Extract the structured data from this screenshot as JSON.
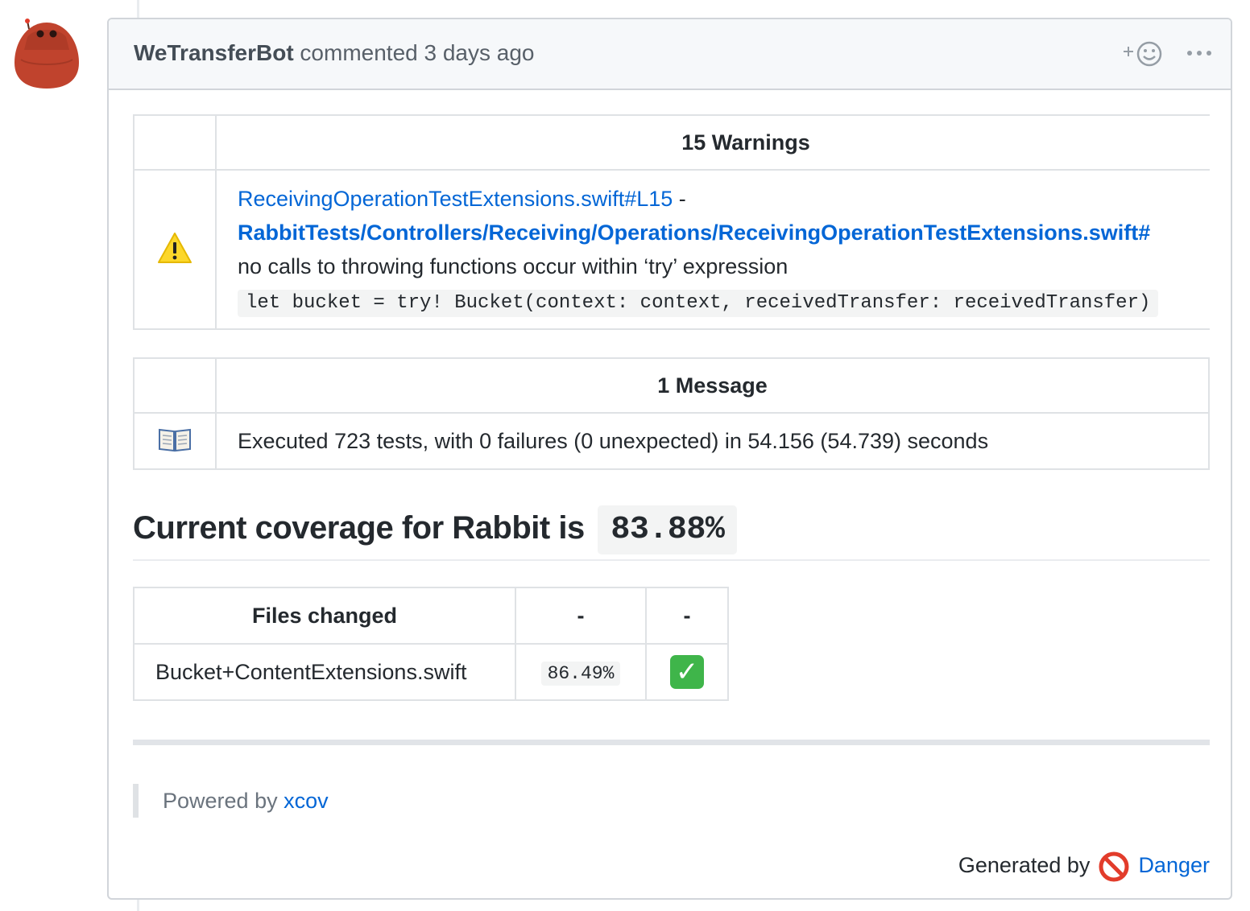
{
  "comment": {
    "author": "WeTransferBot",
    "action": "commented",
    "time": "3 days ago",
    "reaction_icon": "smiley-add-icon",
    "more_icon": "kebab-horizontal-icon"
  },
  "warnings": {
    "title": "15 Warnings",
    "icon": "warning-icon",
    "file_link": "ReceivingOperationTestExtensions.swift#L15",
    "separator": " -",
    "path_link": "RabbitTests/Controllers/Receiving/Operations/ReceivingOperationTestExtensions.swift#",
    "message": "no calls to throwing functions occur within ‘try’ expression",
    "code": "let bucket = try! Bucket(context: context, receivedTransfer: receivedTransfer)"
  },
  "messages": {
    "title": "1 Message",
    "icon": "book-icon",
    "text": "Executed 723 tests, with 0 failures (0 unexpected) in 54.156 (54.739) seconds"
  },
  "coverage": {
    "heading": "Current coverage for Rabbit is",
    "value": "83.88%"
  },
  "files_table": {
    "headers": [
      "Files changed",
      "-",
      "-"
    ],
    "rows": [
      {
        "file": "Bucket+ContentExtensions.swift",
        "percent": "86.49%",
        "status_icon": "check-mark-icon"
      }
    ]
  },
  "footer": {
    "powered_by": "Powered by",
    "powered_link": "xcov",
    "generated_by": "Generated by",
    "generated_icon": "no-entry-icon",
    "generated_link": "Danger"
  },
  "colors": {
    "link": "#0366d6",
    "border": "#dfe2e5",
    "header_bg": "#f6f8fa",
    "check": "#3fb54a",
    "danger": "#e23c2b"
  }
}
